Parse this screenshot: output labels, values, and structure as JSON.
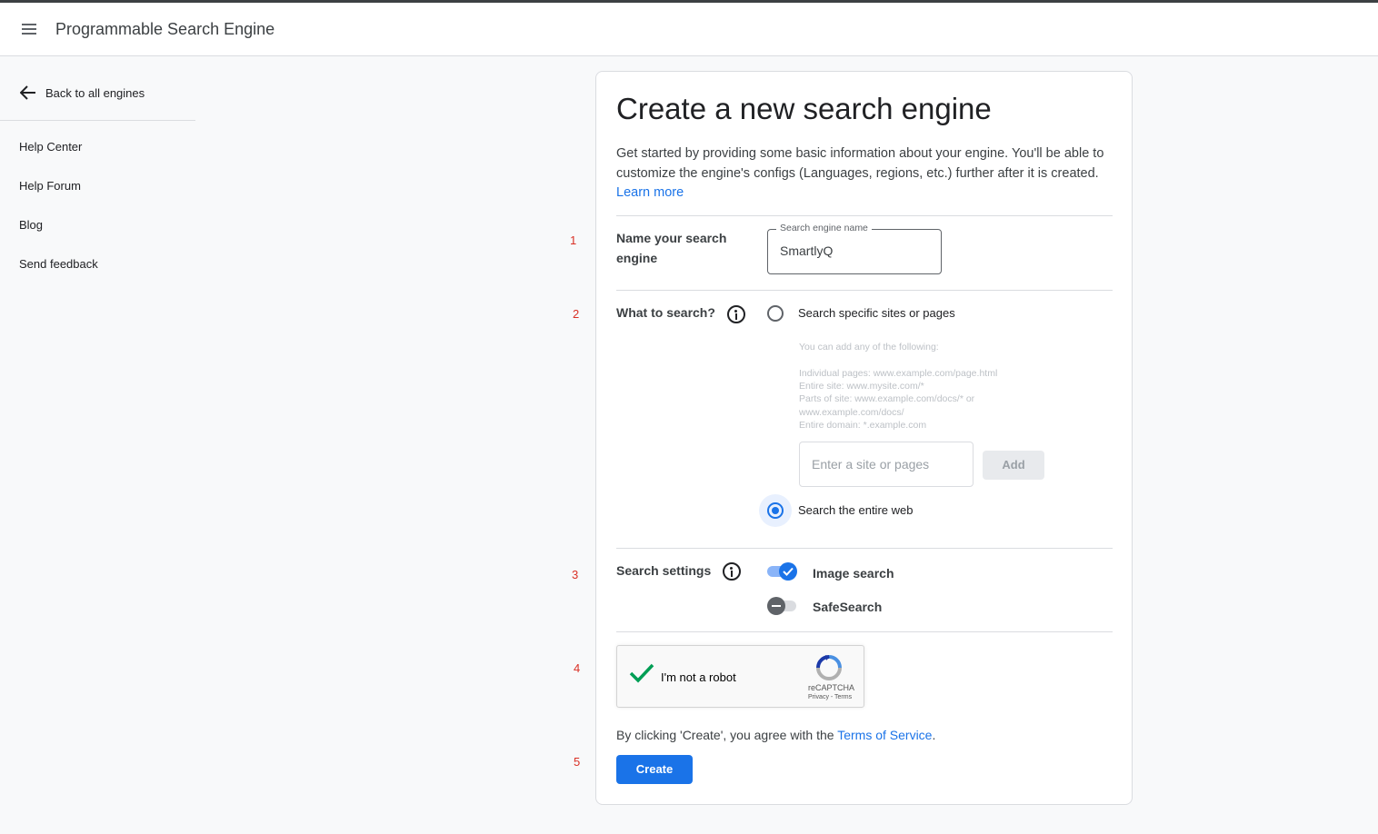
{
  "header": {
    "app_title": "Programmable Search Engine"
  },
  "sidebar": {
    "back_label": "Back to all engines",
    "items": [
      {
        "label": "Help Center"
      },
      {
        "label": "Help Forum"
      },
      {
        "label": "Blog"
      },
      {
        "label": "Send feedback"
      }
    ]
  },
  "form": {
    "title": "Create a new search engine",
    "intro": "Get started by providing some basic information about your engine. You'll be able to customize the engine's configs (Languages, regions, etc.) further after it is created.",
    "learn_more": "Learn more",
    "step_numbers": [
      "1",
      "2",
      "3",
      "4",
      "5"
    ],
    "name_section": {
      "label": "Name your search engine",
      "field_label": "Search engine name",
      "value": "SmartlyQ"
    },
    "what_section": {
      "label": "What to search?",
      "options": [
        {
          "label": "Search specific sites or pages",
          "selected": false
        },
        {
          "label": "Search the entire web",
          "selected": true
        }
      ],
      "hint_lines": [
        "You can add any of the following:",
        "Individual pages: www.example.com/page.html",
        "Entire site: www.mysite.com/*",
        "Parts of site: www.example.com/docs/* or",
        "www.example.com/docs/",
        "Entire domain: *.example.com"
      ],
      "site_placeholder": "Enter a site or pages",
      "add_label": "Add"
    },
    "settings_section": {
      "label": "Search settings",
      "toggles": [
        {
          "label": "Image search",
          "on": true
        },
        {
          "label": "SafeSearch",
          "on": false
        }
      ]
    },
    "captcha": {
      "label": "I'm not a robot",
      "checked": true,
      "brand": "reCAPTCHA",
      "links": "Privacy - Terms"
    },
    "tos": {
      "prefix": "By clicking 'Create', you agree with the ",
      "link": "Terms of Service",
      "suffix": "."
    },
    "create_label": "Create"
  },
  "colors": {
    "accent": "#1a73e8",
    "step_number": "#d93025",
    "captcha_check": "#009e55"
  }
}
